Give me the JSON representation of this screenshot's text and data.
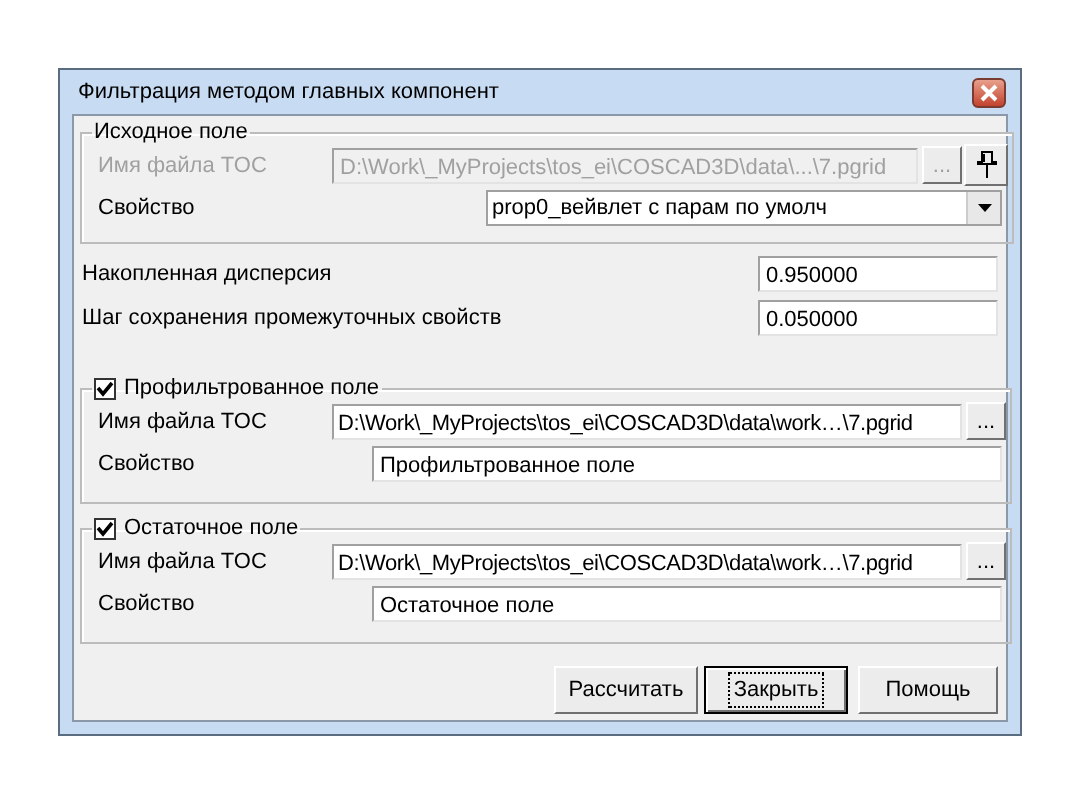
{
  "window": {
    "title": "Фильтрация методом главных компонент"
  },
  "source_group": {
    "title": "Исходное поле",
    "file_label": "Имя файла TOC",
    "file_value": "D:\\Work\\_MyProjects\\tos_ei\\COSCAD3D\\data\\...\\7.pgrid",
    "disabled": true,
    "browse_button": "...",
    "property_label": "Свойство",
    "property_value": "prop0_вейвлет с парам по умолч"
  },
  "parameters": [
    {
      "label": "Накопленная дисперсия",
      "value": "0.950000"
    },
    {
      "label": "Шаг сохранения промежуточных свойств",
      "value": "0.050000"
    }
  ],
  "output_groups": [
    {
      "title": "Профильтрованное поле",
      "checked": true,
      "file_label": "Имя файла TOC",
      "file_value": "D:\\Work\\_MyProjects\\tos_ei\\COSCAD3D\\data\\work…\\7.pgrid",
      "browse_button": "...",
      "property_label": "Свойство",
      "property_value": "Профильтрованное поле"
    },
    {
      "title": "Остаточное поле",
      "checked": true,
      "file_label": "Имя файла TOC",
      "file_value": "D:\\Work\\_MyProjects\\tos_ei\\COSCAD3D\\data\\work…\\7.pgrid",
      "browse_button": "...",
      "property_label": "Свойство",
      "property_value": "Остаточное поле"
    }
  ],
  "buttons": [
    {
      "label": "Рассчитать",
      "focused": false
    },
    {
      "label": "Закрыть",
      "focused": true
    },
    {
      "label": "Помощь",
      "focused": false
    }
  ]
}
